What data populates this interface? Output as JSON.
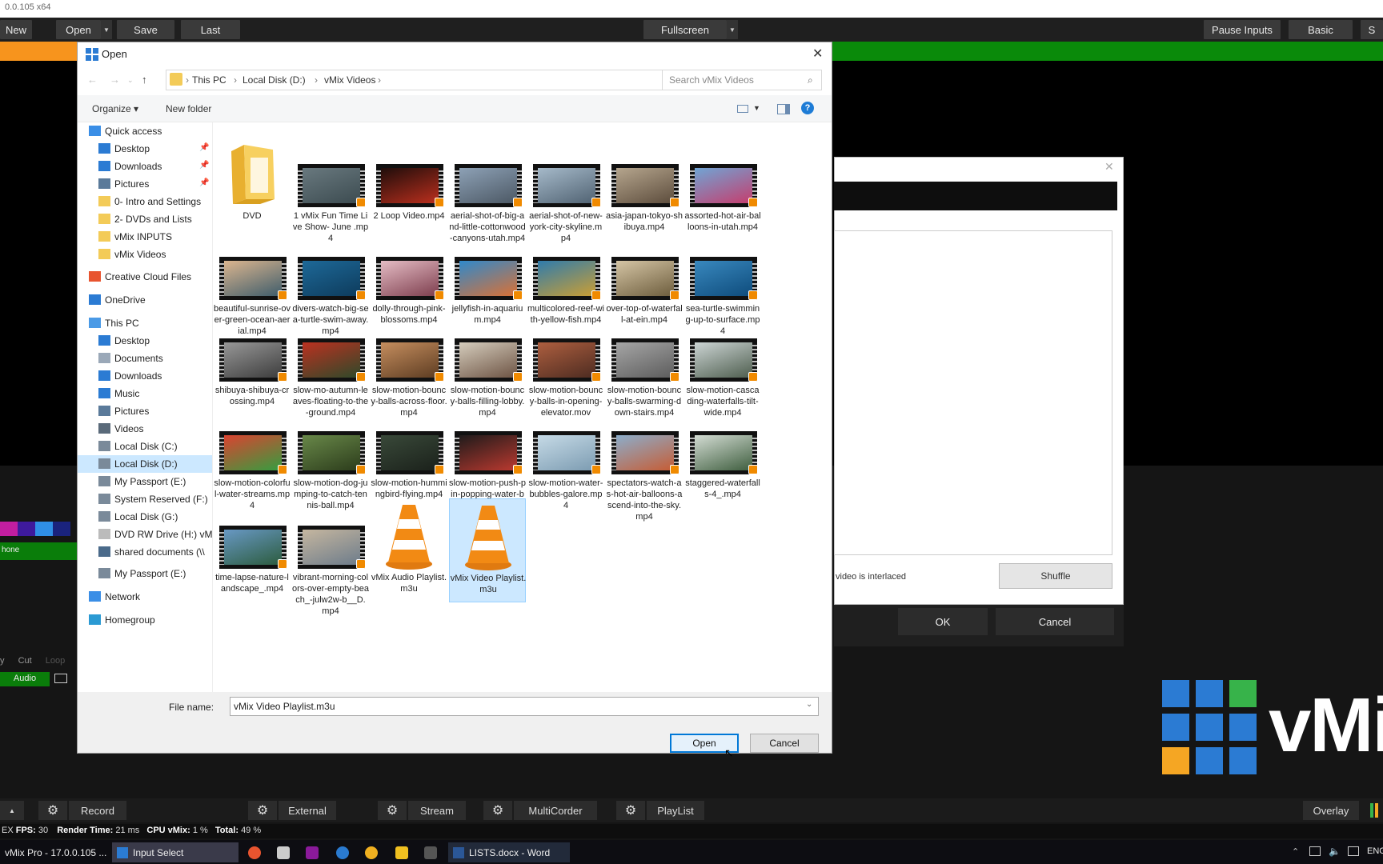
{
  "app": {
    "title": "0.0.105 x64",
    "top_buttons": {
      "new": "New",
      "open": "Open",
      "save": "Save",
      "last": "Last",
      "fullscreen": "Fullscreen",
      "pause_inputs": "Pause Inputs",
      "basic": "Basic",
      "s": "S"
    },
    "colors": {
      "orange": "#f7941d",
      "green": "#0a8a0a",
      "accent": "#0078d7"
    }
  },
  "left_panel": {
    "phone_label": "hone",
    "cut": "Cut",
    "loop": "Loop",
    "y": "y",
    "audio": "Audio"
  },
  "bg_dialog": {
    "interlaced": "video is interlaced",
    "shuffle": "Shuffle",
    "ok": "OK",
    "cancel": "Cancel"
  },
  "logo": {
    "text": "vMi"
  },
  "bottom_bar": {
    "record": "Record",
    "external": "External",
    "stream": "Stream",
    "multicorder": "MultiCorder",
    "playlist": "PlayList",
    "overlay": "Overlay"
  },
  "status": {
    "ex": "EX",
    "fps_label": "FPS:",
    "fps": "30",
    "render_label": "Render Time:",
    "render": "21 ms",
    "cpu_label": "CPU vMix:",
    "cpu": "1 %",
    "total_label": "Total:",
    "total": "49 %"
  },
  "taskbar": {
    "vmix": "vMix Pro - 17.0.0.105 ...",
    "input_select": "Input Select",
    "word": "LISTS.docx - Word",
    "lang": "ENG"
  },
  "dialog": {
    "title": "Open",
    "breadcrumb": [
      "This PC",
      "Local Disk (D:)",
      "vMix Videos"
    ],
    "search_placeholder": "Search vMix Videos",
    "organize": "Organize ▾",
    "new_folder": "New folder",
    "nav": [
      {
        "label": "Quick access",
        "icon": "star-icon",
        "pin": false
      },
      {
        "label": "Desktop",
        "icon": "desktop-icon",
        "pin": true
      },
      {
        "label": "Downloads",
        "icon": "download-icon",
        "pin": true
      },
      {
        "label": "Pictures",
        "icon": "pictures-icon",
        "pin": true
      },
      {
        "label": "0- Intro and Settings",
        "icon": "folder-icon",
        "pin": false
      },
      {
        "label": "2- DVDs and Lists",
        "icon": "folder-icon",
        "pin": false
      },
      {
        "label": "vMix INPUTS",
        "icon": "folder-icon",
        "pin": false
      },
      {
        "label": "vMix Videos",
        "icon": "folder-icon",
        "pin": false
      },
      {
        "label": "Creative Cloud Files",
        "icon": "creative-cloud-icon",
        "pin": false
      },
      {
        "label": "OneDrive",
        "icon": "onedrive-icon",
        "pin": false
      },
      {
        "label": "This PC",
        "icon": "computer-icon",
        "pin": false
      },
      {
        "label": "Desktop",
        "icon": "desktop-icon",
        "pin": false
      },
      {
        "label": "Documents",
        "icon": "documents-icon",
        "pin": false
      },
      {
        "label": "Downloads",
        "icon": "download-icon",
        "pin": false
      },
      {
        "label": "Music",
        "icon": "music-icon",
        "pin": false
      },
      {
        "label": "Pictures",
        "icon": "pictures-icon",
        "pin": false
      },
      {
        "label": "Videos",
        "icon": "videos-icon",
        "pin": false
      },
      {
        "label": "Local Disk (C:)",
        "icon": "drive-icon",
        "pin": false
      },
      {
        "label": "Local Disk (D:)",
        "icon": "drive-icon",
        "pin": false
      },
      {
        "label": "My Passport (E:)",
        "icon": "drive-icon",
        "pin": false
      },
      {
        "label": "System Reserved (F:)",
        "icon": "drive-icon",
        "pin": false
      },
      {
        "label": "Local Disk (G:)",
        "icon": "drive-icon",
        "pin": false
      },
      {
        "label": "DVD RW Drive (H:) vM",
        "icon": "dvd-icon",
        "pin": false
      },
      {
        "label": "shared documents (\\\\",
        "icon": "network-drive-icon",
        "pin": false
      },
      {
        "label": "My Passport (E:)",
        "icon": "drive-icon",
        "pin": false
      },
      {
        "label": "Network",
        "icon": "network-icon",
        "pin": false
      },
      {
        "label": "Homegroup",
        "icon": "homegroup-icon",
        "pin": false
      }
    ],
    "selected_nav_index": 18,
    "files": [
      {
        "name": "DVD",
        "type": "folder"
      },
      {
        "name": "1 vMix Fun Time Live Show- June .mp4",
        "type": "video",
        "colors": [
          "#6a7a80",
          "#3b4a4f"
        ]
      },
      {
        "name": "2 Loop Video.mp4",
        "type": "video",
        "colors": [
          "#1a0c0a",
          "#c0301e"
        ]
      },
      {
        "name": "aerial-shot-of-big-and-little-cottonwood-canyons-utah.mp4",
        "type": "video",
        "colors": [
          "#8fa3b8",
          "#4a5662"
        ]
      },
      {
        "name": "aerial-shot-of-new-york-city-skyline.mp4",
        "type": "video",
        "colors": [
          "#a8bccc",
          "#4e6070"
        ]
      },
      {
        "name": "asia-japan-tokyo-shibuya.mp4",
        "type": "video",
        "colors": [
          "#b8a890",
          "#5a4a3a"
        ]
      },
      {
        "name": "assorted-hot-air-balloons-in-utah.mp4",
        "type": "video",
        "colors": [
          "#6da8d8",
          "#c83a6a"
        ]
      },
      {
        "name": "beautiful-sunrise-over-green-ocean-aerial.mp4",
        "type": "video",
        "colors": [
          "#e0b890",
          "#3a5a6a"
        ]
      },
      {
        "name": "divers-watch-big-sea-turtle-swim-away.mp4",
        "type": "video",
        "colors": [
          "#1e6a9a",
          "#0d3a5a"
        ]
      },
      {
        "name": "dolly-through-pink-blossoms.mp4",
        "type": "video",
        "colors": [
          "#e8c0c8",
          "#7a3a4a"
        ]
      },
      {
        "name": "jellyfish-in-aquarium.mp4",
        "type": "video",
        "colors": [
          "#2a8ad0",
          "#e07030"
        ]
      },
      {
        "name": "multicolored-reef-with-yellow-fish.mp4",
        "type": "video",
        "colors": [
          "#2a7ab0",
          "#d0a030"
        ]
      },
      {
        "name": "over-top-of-waterfall-at-ein.mp4",
        "type": "video",
        "colors": [
          "#d8c8a8",
          "#6a5a3a"
        ]
      },
      {
        "name": "sea-turtle-swimming-up-to-surface.mp4",
        "type": "video",
        "colors": [
          "#3a8ac0",
          "#0d4a7a"
        ]
      },
      {
        "name": "shibuya-shibuya-crossing.mp4",
        "type": "video",
        "colors": [
          "#9a9a9a",
          "#3a3a3a"
        ]
      },
      {
        "name": "slow-mo-autumn-leaves-floating-to-the-ground.mp4",
        "type": "video",
        "colors": [
          "#c03020",
          "#2a4a2a"
        ]
      },
      {
        "name": "slow-motion-bouncy-balls-across-floor.mp4",
        "type": "video",
        "colors": [
          "#c89060",
          "#5a3a20"
        ]
      },
      {
        "name": "slow-motion-bouncy-balls-filling-lobby.mp4",
        "type": "video",
        "colors": [
          "#d8d0c0",
          "#6a5040"
        ]
      },
      {
        "name": "slow-motion-bouncy-balls-in-opening-elevator.mov",
        "type": "video",
        "colors": [
          "#b06040",
          "#4a2a20"
        ]
      },
      {
        "name": "slow-motion-bouncy-balls-swarming-down-stairs.mp4",
        "type": "video",
        "colors": [
          "#a8a8a8",
          "#5a5a5a"
        ]
      },
      {
        "name": "slow-motion-cascading-waterfalls-tilt-wide.mp4",
        "type": "video",
        "colors": [
          "#d0d8d8",
          "#4a5a4a"
        ]
      },
      {
        "name": "slow-motion-colorful-water-streams.mp4",
        "type": "video",
        "colors": [
          "#e04030",
          "#30a040"
        ]
      },
      {
        "name": "slow-motion-dog-jumping-to-catch-tennis-ball.mp4",
        "type": "video",
        "colors": [
          "#6a8a4a",
          "#2a3a1a"
        ]
      },
      {
        "name": "slow-motion-hummingbird-flying.mp4",
        "type": "video",
        "colors": [
          "#3a4a3a",
          "#1a201a"
        ]
      },
      {
        "name": "slow-motion-push-pin-popping-water-balloon.mp4",
        "type": "video",
        "colors": [
          "#1a1a1a",
          "#c03a30"
        ]
      },
      {
        "name": "slow-motion-water-bubbles-galore.mp4",
        "type": "video",
        "colors": [
          "#c8dce8",
          "#7a9ab0"
        ]
      },
      {
        "name": "spectators-watch-as-hot-air-balloons-ascend-into-the-sky.mp4",
        "type": "video",
        "colors": [
          "#8ab0d0",
          "#c85a30"
        ]
      },
      {
        "name": "staggered-waterfalls-4_.mp4",
        "type": "video",
        "colors": [
          "#d8e0d8",
          "#3a5a3a"
        ]
      },
      {
        "name": "time-lapse-nature-landscape_.mp4",
        "type": "video",
        "colors": [
          "#6a9ac8",
          "#2a5a3a"
        ]
      },
      {
        "name": "vibrant-morning-colors-over-empty-beach_-julw2w-b__D.mp4",
        "type": "video",
        "colors": [
          "#c8b8a0",
          "#6a7a8a"
        ]
      },
      {
        "name": "vMix Audio Playlist.m3u",
        "type": "playlist"
      },
      {
        "name": "vMix Video Playlist.m3u",
        "type": "playlist",
        "selected": true
      }
    ],
    "file_name_label": "File name:",
    "file_name_value": "vMix Video Playlist.m3u",
    "open_button": "Open",
    "cancel_button": "Cancel"
  }
}
